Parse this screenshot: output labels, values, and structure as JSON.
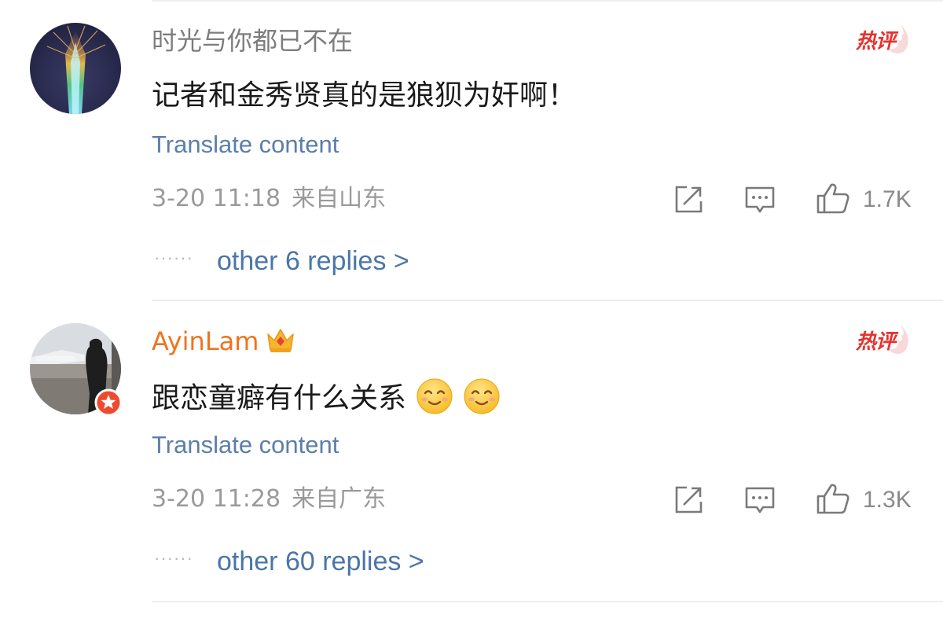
{
  "comments": [
    {
      "username": "时光与你都已不在",
      "hot_badge": "热评",
      "content": "记者和金秀贤真的是狼狈为奸啊！",
      "translate_label": "Translate content",
      "time": "3-20 11:18",
      "location": "来自山东",
      "likes": "1.7K",
      "replies_label": "other 6 replies >",
      "icons": [
        "share-icon",
        "comment-icon",
        "like-icon"
      ]
    },
    {
      "username": "AyinLam",
      "hot_badge": "热评",
      "content": "跟恋童癖有什么关系",
      "translate_label": "Translate content",
      "time": "3-20 11:28",
      "location": "来自广东",
      "likes": "1.3K",
      "replies_label": "other 60 replies >",
      "icons": [
        "share-icon",
        "comment-icon",
        "like-icon"
      ],
      "emojis": [
        "smile-emoji",
        "smile-emoji"
      ],
      "badge_icon": "crown-icon"
    }
  ],
  "colors": {
    "link": "#5b7fa8",
    "vip_name": "#f0731f",
    "hot": "#e8312d",
    "meta": "#9a9a9a"
  }
}
